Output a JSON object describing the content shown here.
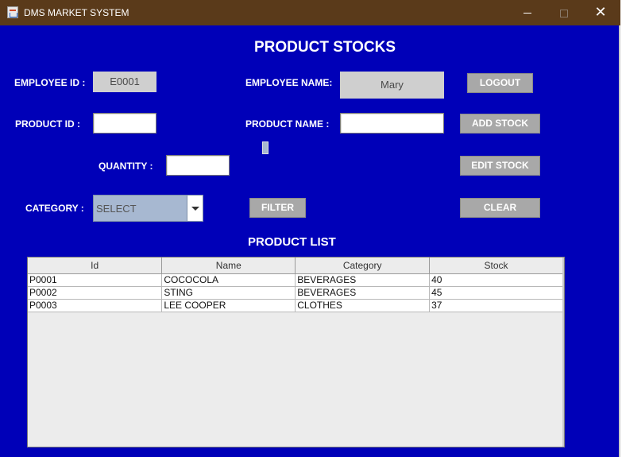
{
  "window": {
    "title": "DMS MARKET SYSTEM",
    "close_glyph": "✕"
  },
  "page": {
    "title": "PRODUCT STOCKS",
    "list_title": "PRODUCT LIST"
  },
  "form": {
    "employee_id_label": "EMPLOYEE ID :",
    "employee_id_value": "E0001",
    "employee_name_label": "EMPLOYEE NAME:",
    "employee_name_value": "Mary",
    "product_id_label": "PRODUCT ID :",
    "product_id_value": "",
    "product_name_label": "PRODUCT NAME :",
    "product_name_value": "",
    "quantity_label": "QUANTITY :",
    "quantity_value": "",
    "category_label": "CATEGORY :",
    "category_selected": "SELECT"
  },
  "buttons": {
    "logout": "LOGOUT",
    "add_stock": "ADD STOCK",
    "edit_stock": "EDIT STOCK",
    "filter": "FILTER",
    "clear": "CLEAR"
  },
  "table": {
    "columns": [
      "Id",
      "Name",
      "Category",
      "Stock"
    ],
    "rows": [
      [
        "P0001",
        "COCOCOLA",
        "BEVERAGES",
        "40"
      ],
      [
        "P0002",
        "STING",
        "BEVERAGES",
        "45"
      ],
      [
        "P0003",
        "LEE COOPER",
        "CLOTHES",
        "37"
      ]
    ]
  },
  "colors": {
    "background": "#0000b8",
    "titlebar": "#5a3a1a",
    "button": "#a8a8a8",
    "combo": "#a7b8d1"
  },
  "icons": {
    "app": "java-cup-icon",
    "dropdown": "chevron-down-icon"
  }
}
